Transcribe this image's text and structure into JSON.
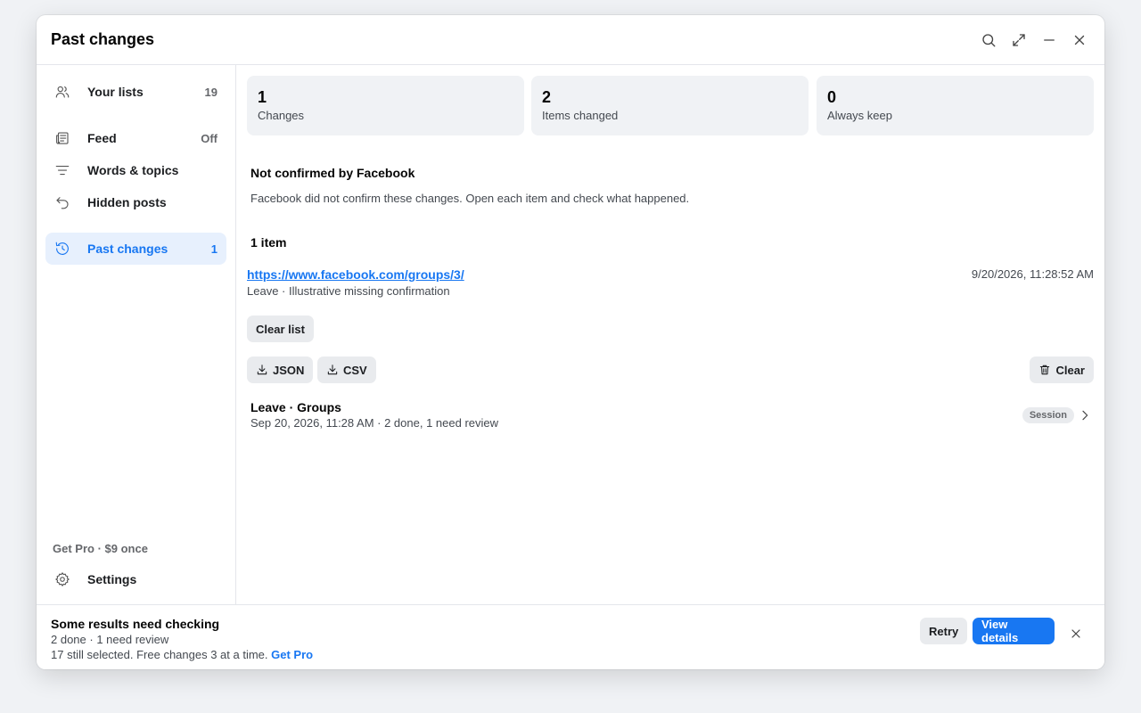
{
  "window": {
    "title": "Past changes"
  },
  "icons": {
    "search": "search-icon",
    "expand": "expand-icon",
    "minimize": "minimize-icon",
    "close": "close-icon"
  },
  "colors": {
    "accent": "#1877f2",
    "active_bg": "#e7f0fd",
    "card_bg": "#f0f2f5"
  },
  "sidebar": {
    "items": [
      {
        "label": "Your lists",
        "count": "19",
        "icon": "users-icon"
      },
      {
        "label": "Feed",
        "count": "Off",
        "icon": "newspaper-icon"
      },
      {
        "label": "Words & topics",
        "count": "",
        "icon": "filter-icon"
      },
      {
        "label": "Hidden posts",
        "count": "",
        "icon": "undo-icon"
      },
      {
        "label": "Past changes",
        "count": "1",
        "icon": "history-icon",
        "active": true
      }
    ],
    "promo": "Get Pro · $9 once",
    "settings_label": "Settings"
  },
  "stats": [
    {
      "value": "1",
      "label": "Changes"
    },
    {
      "value": "2",
      "label": "Items changed"
    },
    {
      "value": "0",
      "label": "Always keep"
    }
  ],
  "section": {
    "title": "Not confirmed by Facebook",
    "description": "Facebook did not confirm these changes. Open each item and check what happened.",
    "count_label": "1 item"
  },
  "item": {
    "url": "https://www.facebook.com/groups/3/",
    "date": "9/20/2026, 11:28:52 AM",
    "subtitle": "Leave · Illustrative missing confirmation"
  },
  "actions": {
    "clear_list": "Clear list",
    "json": "JSON",
    "csv": "CSV",
    "clear": "Clear"
  },
  "session": {
    "title": "Leave · Groups",
    "subtitle": "Sep 20, 2026, 11:28 AM · 2 done, 1 need review",
    "badge": "Session"
  },
  "footer": {
    "title": "Some results need checking",
    "summary": "2 done · 1 need review",
    "note": "17 still selected. Free changes 3 at a time.",
    "link": "Get Pro",
    "retry": "Retry",
    "view_details": "View details"
  }
}
